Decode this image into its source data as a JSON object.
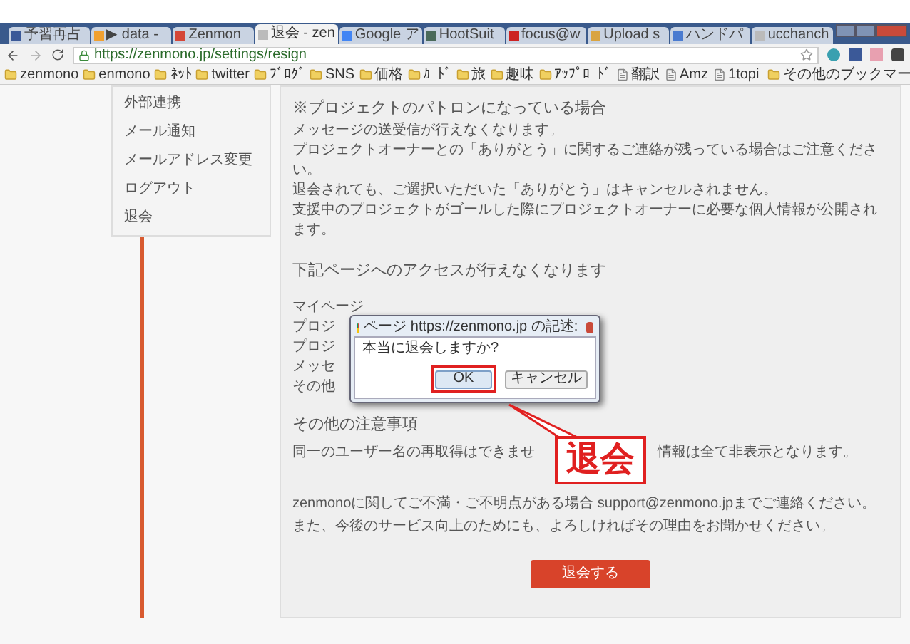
{
  "browser": {
    "tabs": [
      {
        "label": "予習再占",
        "selected": false,
        "color": "#3b5998"
      },
      {
        "label": "▶ data -",
        "selected": false,
        "color": "#f0a030"
      },
      {
        "label": "Zenmon",
        "selected": false,
        "color": "#d44638"
      },
      {
        "label": "退会 - zen",
        "selected": true,
        "color": "#bbbbbb"
      },
      {
        "label": "Google ア",
        "selected": false,
        "color": "#4285f4"
      },
      {
        "label": "HootSuit",
        "selected": false,
        "color": "#4a6a5a"
      },
      {
        "label": "focus@w",
        "selected": false,
        "color": "#cc2222"
      },
      {
        "label": "Upload s",
        "selected": false,
        "color": "#d9a441"
      },
      {
        "label": "ハンドパ",
        "selected": false,
        "color": "#4a7bd0"
      },
      {
        "label": "ucchanch",
        "selected": false,
        "color": "#bbbbbb"
      }
    ],
    "url": "https://zenmono.jp/settings/resign",
    "bookmarks": [
      {
        "label": "zenmono",
        "kind": "folder"
      },
      {
        "label": "enmono",
        "kind": "folder"
      },
      {
        "label": "ﾈｯﾄ",
        "kind": "folder"
      },
      {
        "label": "twitter",
        "kind": "folder"
      },
      {
        "label": "ﾌﾞﾛｸﾞ",
        "kind": "folder"
      },
      {
        "label": "SNS",
        "kind": "folder"
      },
      {
        "label": "価格",
        "kind": "folder"
      },
      {
        "label": "ｶｰﾄﾞ",
        "kind": "folder"
      },
      {
        "label": "旅",
        "kind": "folder"
      },
      {
        "label": "趣味",
        "kind": "folder"
      },
      {
        "label": "ｱｯﾌﾟﾛｰﾄﾞ",
        "kind": "folder"
      },
      {
        "label": "翻訳",
        "kind": "page"
      },
      {
        "label": "Amz",
        "kind": "page"
      },
      {
        "label": "1topi",
        "kind": "page"
      }
    ],
    "other_bookmarks": "その他のブックマー"
  },
  "sidebar": {
    "items": [
      "外部連携",
      "メール通知",
      "メールアドレス変更",
      "ログアウト",
      "退会"
    ]
  },
  "content": {
    "heading_patron": "※プロジェクトのパトロンになっている場合",
    "patron_notes": [
      "メッセージの送受信が行えなくなります。",
      "プロジェクトオーナーとの「ありがとう」に関するご連絡が残っている場合はご注意ください。",
      "退会されても、ご選択いただいた「ありがとう」はキャンセルされません。",
      "支援中のプロジェクトがゴールした際にプロジェクトオーナーに必要な個人情報が公開されます。"
    ],
    "heading_access": "下記ページへのアクセスが行えなくなります",
    "pages": [
      "マイページ",
      "プロジ",
      "プロジ",
      "メッセ",
      "その他"
    ],
    "heading_other": "その他の注意事項",
    "other_note_left": "同一のユーザー名の再取得はできませ",
    "other_note_right": "情報は全て非表示となります。",
    "contact": [
      "zenmonoに関してご不満・ご不明点がある場合 support@zenmono.jpまでご連絡ください。",
      "また、今後のサービス向上のためにも、よろしければその理由をお聞かせください。"
    ],
    "resign_button": "退会する"
  },
  "dialog": {
    "title": "ページ https://zenmono.jp の記述:",
    "message": "本当に退会しますか?",
    "ok": "OK",
    "cancel": "キャンセル"
  },
  "callout": {
    "label": "退会"
  }
}
